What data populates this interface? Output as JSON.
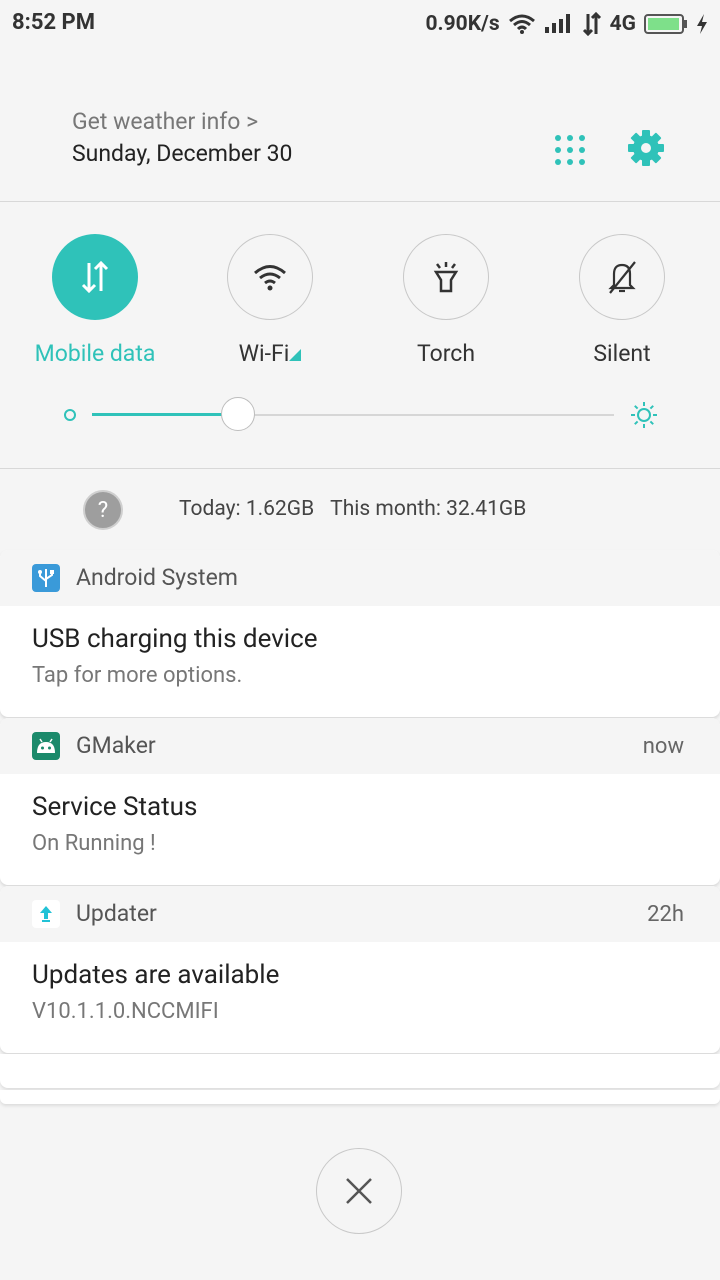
{
  "status_bar": {
    "time": "8:52 PM",
    "speed": "0.90K/s",
    "network": "4G",
    "icons": [
      "wifi-icon",
      "signal-icon",
      "data-transfer-icon",
      "battery-icon",
      "charging-icon"
    ]
  },
  "header": {
    "weather_link": "Get weather info >",
    "date": "Sunday, December 30"
  },
  "toggles": [
    {
      "label": "Mobile data",
      "icon": "mobile-data-icon",
      "active": true
    },
    {
      "label": "Wi-Fi",
      "icon": "wifi-icon",
      "active": false
    },
    {
      "label": "Torch",
      "icon": "torch-icon",
      "active": false
    },
    {
      "label": "Silent",
      "icon": "silent-icon",
      "active": false
    }
  ],
  "brightness": {
    "level": 0.28
  },
  "data_usage": {
    "help": "?",
    "today": "Today: 1.62GB",
    "month": "This month: 32.41GB"
  },
  "notifications": [
    {
      "app": "Android System",
      "time": "",
      "title": "USB charging this device",
      "body": "Tap for more options."
    },
    {
      "app": "GMaker",
      "time": "now",
      "title": "Service Status",
      "body": "On Running !"
    },
    {
      "app": "Updater",
      "time": "22h",
      "title": "Updates are available",
      "body": "V10.1.1.0.NCCMIFI"
    }
  ],
  "colors": {
    "accent": "#2fc2b9",
    "background": "#f5f5f5"
  }
}
